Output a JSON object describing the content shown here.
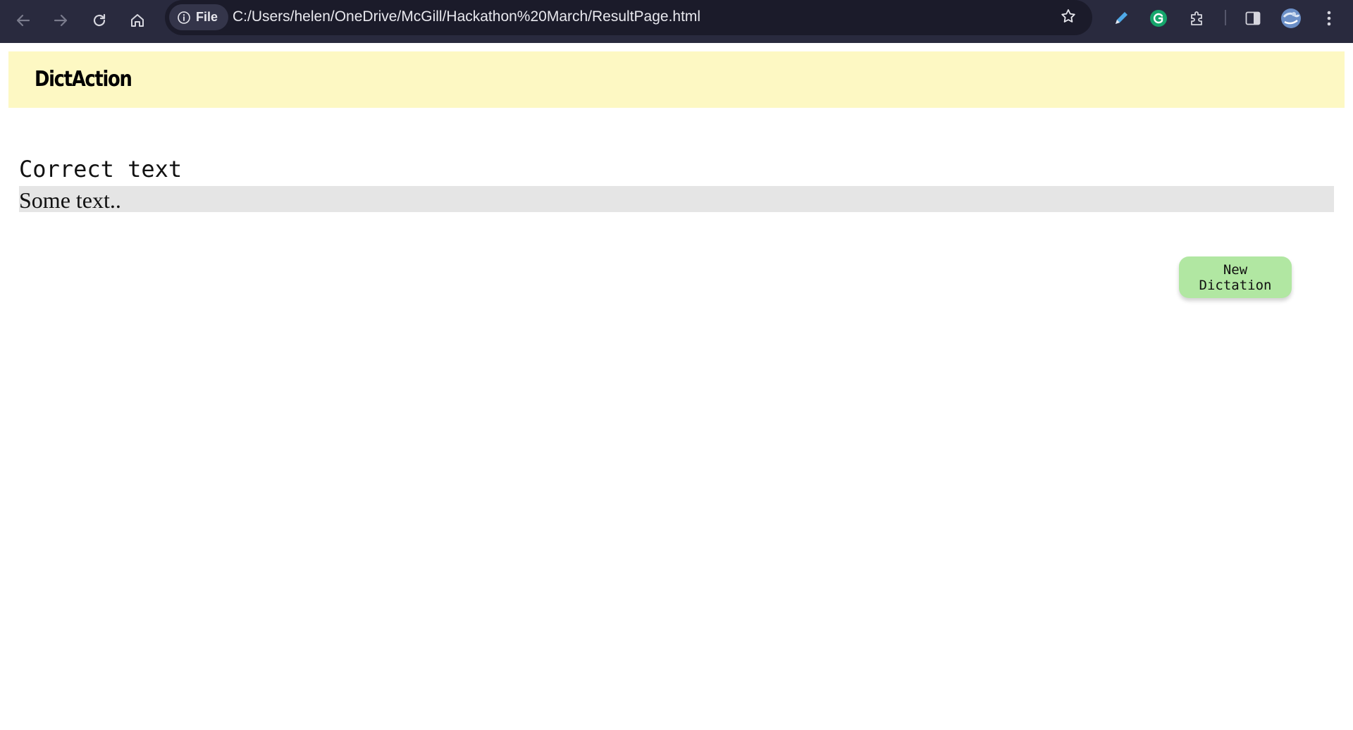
{
  "browser": {
    "site_chip_label": "File",
    "url": "C:/Users/helen/OneDrive/McGill/Hackathon%20March/ResultPage.html",
    "icons": [
      "back-icon",
      "forward-icon",
      "reload-icon",
      "home-icon",
      "info-icon",
      "star-icon",
      "pen-icon",
      "grammarly-icon",
      "extensions-icon",
      "side-panel-icon",
      "profile-avatar",
      "more-menu-icon"
    ]
  },
  "header": {
    "brand": "DictAction"
  },
  "main": {
    "section_label": "Correct text",
    "correct_text": "Some text.."
  },
  "actions": {
    "new_dictation_label": "New Dictation"
  },
  "colors": {
    "chrome_bg": "#292a3e",
    "header_bg": "#fdf8c3",
    "text_box_bg": "#e5e5e5",
    "button_bg": "#b1e7a2"
  }
}
